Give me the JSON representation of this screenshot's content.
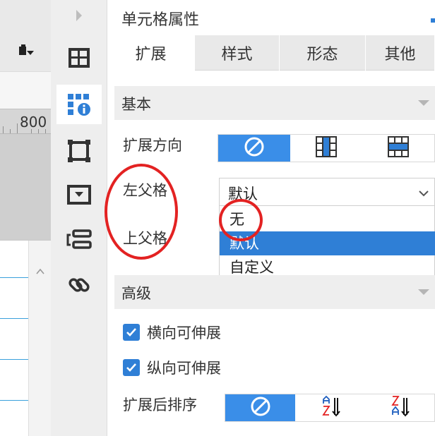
{
  "canvas": {
    "ruler_value": "800"
  },
  "rail": {
    "items": [
      {
        "icon": "cell-layout-icon",
        "active": false
      },
      {
        "icon": "cell-properties-icon",
        "active": true
      },
      {
        "icon": "frame-icon",
        "active": false
      },
      {
        "icon": "widget-dropdown-icon",
        "active": false
      },
      {
        "icon": "report-block-icon",
        "active": false
      },
      {
        "icon": "hyperlink-icon",
        "active": false
      }
    ]
  },
  "panel": {
    "title": "单元格属性",
    "tabs": [
      {
        "label": "扩展",
        "active": true
      },
      {
        "label": "样式",
        "active": false
      },
      {
        "label": "形态",
        "active": false
      },
      {
        "label": "其他",
        "active": false
      }
    ],
    "basic": {
      "section_label": "基本",
      "expand_direction_label": "扩展方向",
      "expand_direction_options": [
        "none-icon",
        "vertical-expand-icon",
        "horizontal-expand-icon"
      ],
      "left_parent_label": "左父格",
      "left_parent_value": "默认",
      "top_parent_label": "上父格",
      "dropdown_options": [
        {
          "label": "无",
          "selected": false
        },
        {
          "label": "默认",
          "selected": true
        },
        {
          "label": "自定义",
          "selected": false
        }
      ]
    },
    "advanced": {
      "section_label": "高级",
      "horizontal_stretch_label": "横向可伸展",
      "horizontal_stretch_checked": true,
      "vertical_stretch_label": "纵向可伸展",
      "vertical_stretch_checked": true,
      "sort_after_expand_label": "扩展后排序",
      "sort_options": [
        "none-icon",
        "sort-ascending-icon",
        "sort-descending-icon"
      ]
    }
  },
  "colors": {
    "accent": "#2f7fd6",
    "segment_active": "#3a8ee8",
    "highlight_ring": "#e32222"
  }
}
